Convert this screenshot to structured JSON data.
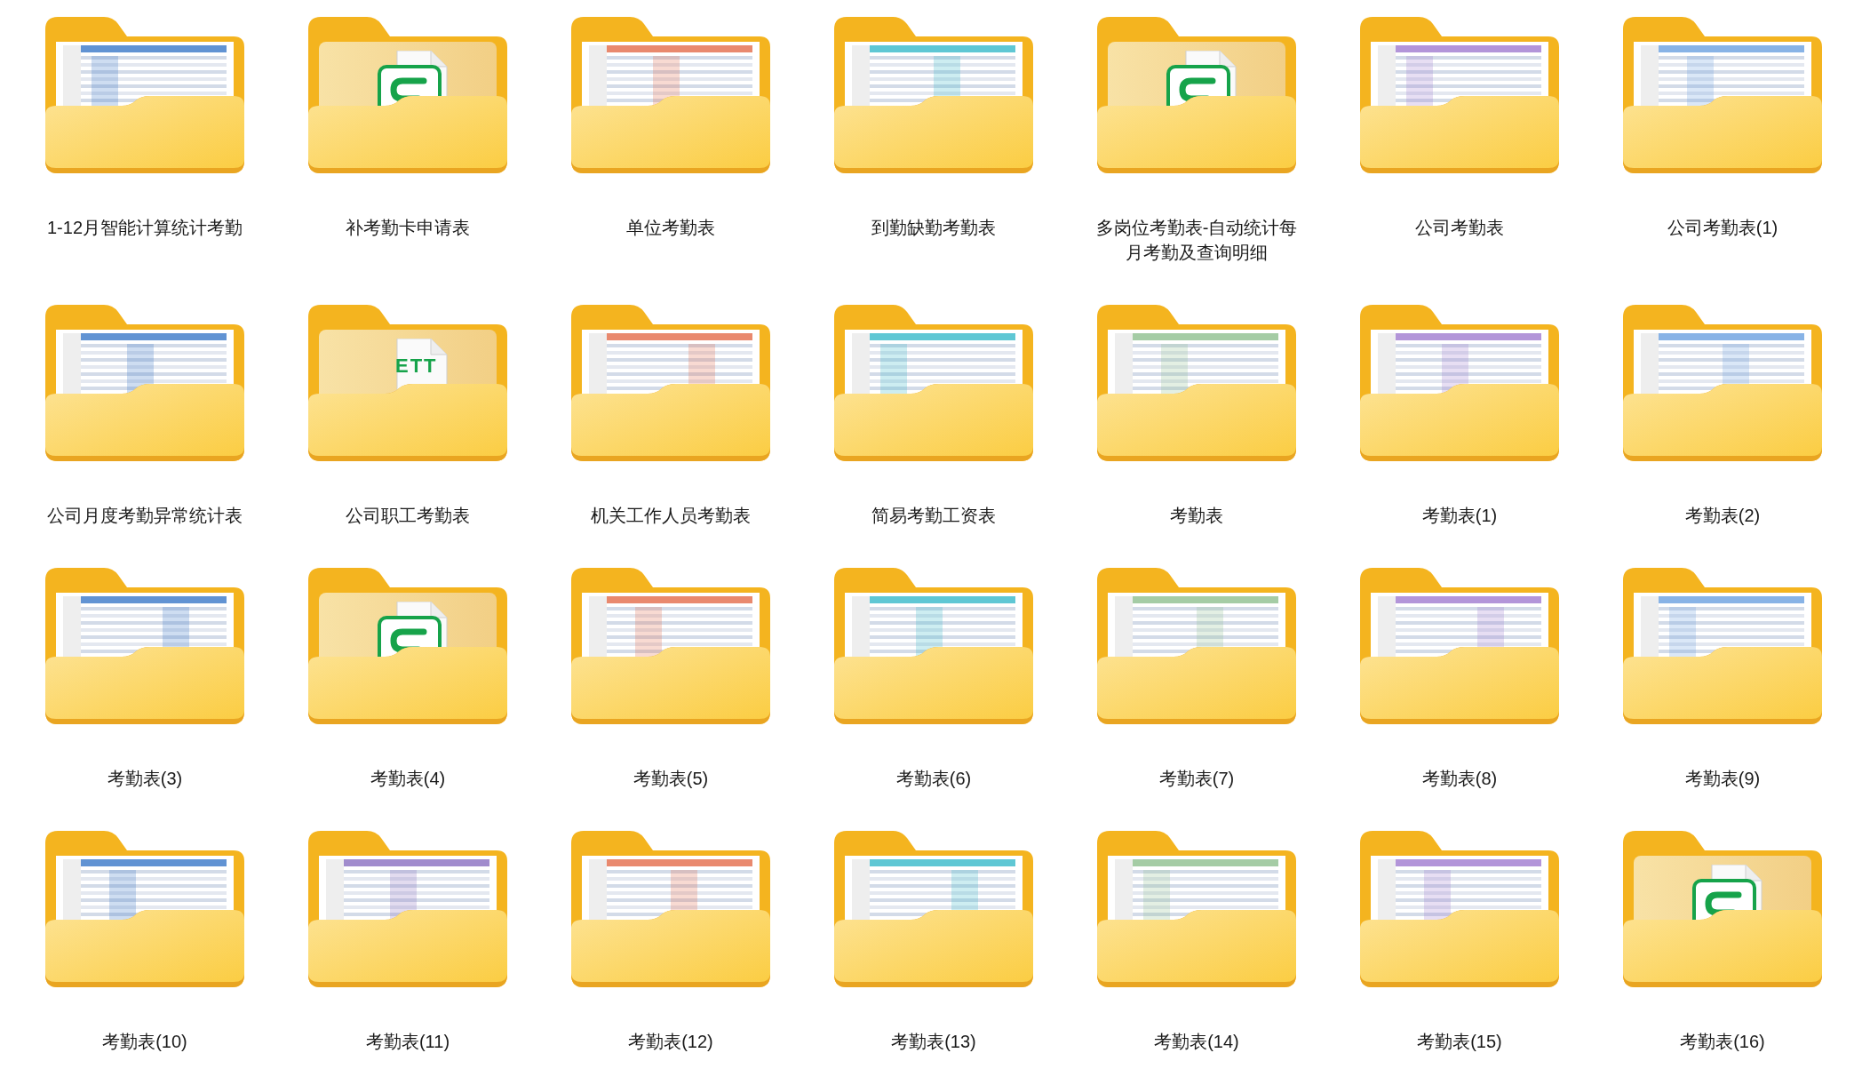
{
  "folders": [
    {
      "name": "1-12月智能计算统计考勤",
      "kind": "picture"
    },
    {
      "name": "补考勤卡申请表",
      "kind": "sheet-app"
    },
    {
      "name": "单位考勤表",
      "kind": "picture"
    },
    {
      "name": "到勤缺勤考勤表",
      "kind": "picture"
    },
    {
      "name": "多岗位考勤表-自动统计每月考勤及查询明细",
      "kind": "sheet-app"
    },
    {
      "name": "公司考勤表",
      "kind": "picture"
    },
    {
      "name": "公司考勤表(1)",
      "kind": "picture"
    },
    {
      "name": "公司月度考勤异常统计表",
      "kind": "picture"
    },
    {
      "name": "公司职工考勤表",
      "kind": "text-app",
      "icon_text": "ETT"
    },
    {
      "name": "机关工作人员考勤表",
      "kind": "picture"
    },
    {
      "name": "简易考勤工资表",
      "kind": "picture"
    },
    {
      "name": "考勤表",
      "kind": "picture"
    },
    {
      "name": "考勤表(1)",
      "kind": "picture"
    },
    {
      "name": "考勤表(2)",
      "kind": "picture"
    },
    {
      "name": "考勤表(3)",
      "kind": "picture"
    },
    {
      "name": "考勤表(4)",
      "kind": "sheet-app"
    },
    {
      "name": "考勤表(5)",
      "kind": "picture"
    },
    {
      "name": "考勤表(6)",
      "kind": "picture"
    },
    {
      "name": "考勤表(7)",
      "kind": "picture"
    },
    {
      "name": "考勤表(8)",
      "kind": "picture"
    },
    {
      "name": "考勤表(9)",
      "kind": "picture"
    },
    {
      "name": "考勤表(10)",
      "kind": "picture"
    },
    {
      "name": "考勤表(11)",
      "kind": "picture"
    },
    {
      "name": "考勤表(12)",
      "kind": "picture"
    },
    {
      "name": "考勤表(13)",
      "kind": "picture"
    },
    {
      "name": "考勤表(14)",
      "kind": "picture"
    },
    {
      "name": "考勤表(15)",
      "kind": "picture"
    },
    {
      "name": "考勤表(16)",
      "kind": "sheet-app"
    }
  ]
}
